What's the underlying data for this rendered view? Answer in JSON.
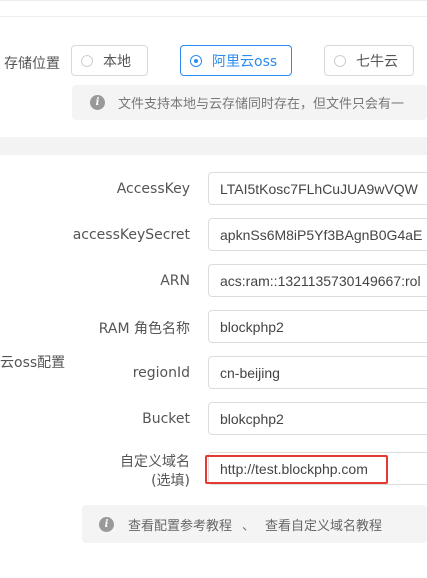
{
  "storage": {
    "label": "存储位置",
    "options": [
      {
        "label": "本地",
        "selected": false
      },
      {
        "label": "阿里云oss",
        "selected": true
      },
      {
        "label": "七牛云",
        "selected": false
      }
    ],
    "notice": "文件支持本地与云存储同时存在，但文件只会有一"
  },
  "oss_config": {
    "section_label": "云oss配置",
    "fields": [
      {
        "label": "AccessKey",
        "value": "LTAI5tKosc7FLhCuJUA9wVQW"
      },
      {
        "label": "accessKeySecret",
        "value": "apknSs6M8iP5Yf3BAgnB0G4aE"
      },
      {
        "label": "ARN",
        "value": "acs:ram::1321135730149667:rol"
      },
      {
        "label": "RAM 角色名称",
        "value": "blockphp2"
      },
      {
        "label": "regionId",
        "value": "cn-beijing"
      },
      {
        "label": "Bucket",
        "value": "blokcphp2"
      },
      {
        "label_line1": "自定义域名",
        "label_line2": "(选填)",
        "value": "http://test.blockphp.com"
      }
    ],
    "help": {
      "link1": "查看配置参考教程",
      "separator": "、",
      "link2": "查看自定义域名教程"
    }
  },
  "colors": {
    "accent": "#2c8cf0",
    "highlight": "#e53935"
  }
}
